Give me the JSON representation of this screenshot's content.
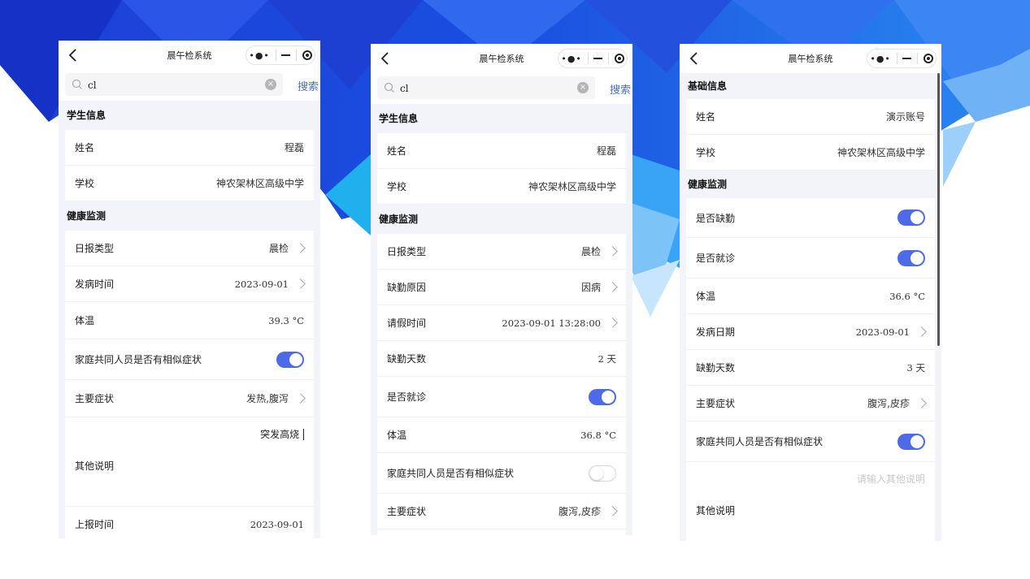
{
  "colors": {
    "accent": "#4d6be8",
    "page_bg": "#f3f4f9",
    "banner_blue": "#1a4fe0"
  },
  "icons": [
    "back-arrow-icon",
    "search-icon",
    "clear-icon",
    "more-dots-icon",
    "minimize-icon",
    "close-target-icon",
    "chevron-right-icon"
  ],
  "phone1": {
    "title": "晨午检系统",
    "search": {
      "value": "cl",
      "button": "搜索"
    },
    "student_section": "学生信息",
    "name_label": "姓名",
    "name_value": "程磊",
    "school_label": "学校",
    "school_value": "神农架林区高级中学",
    "health_section": "健康监测",
    "report_type_label": "日报类型",
    "report_type_value": "晨检",
    "onset_label": "发病时间",
    "onset_value": "2023-09-01",
    "temp_label": "体温",
    "temp_value": "39.3 °C",
    "family_label": "家庭共同人员是否有相似症状",
    "family_on": true,
    "symptoms_label": "主要症状",
    "symptoms_value": "发热,腹泻",
    "other_value": "突发高烧",
    "other_label": "其他说明",
    "report_time_label": "上报时间",
    "report_time_value": "2023-09-01"
  },
  "phone2": {
    "title": "晨午检系统",
    "search": {
      "value": "cl",
      "button": "搜索"
    },
    "student_section": "学生信息",
    "name_label": "姓名",
    "name_value": "程磊",
    "school_label": "学校",
    "school_value": "神农架林区高级中学",
    "health_section": "健康监测",
    "report_type_label": "日报类型",
    "report_type_value": "晨检",
    "absence_reason_label": "缺勤原因",
    "absence_reason_value": "因病",
    "leave_time_label": "请假时间",
    "leave_time_value": "2023-09-01 13:28:00",
    "absence_days_label": "缺勤天数",
    "absence_days_value": "2 天",
    "visited_label": "是否就诊",
    "visited_on": true,
    "temp_label": "体温",
    "temp_value": "36.8 °C",
    "family_label": "家庭共同人员是否有相似症状",
    "family_on": false,
    "symptoms_label": "主要症状",
    "symptoms_value": "腹泻,皮疹"
  },
  "phone3": {
    "title": "晨午检系统",
    "basic_section": "基础信息",
    "name_label": "姓名",
    "name_value": "演示账号",
    "school_label": "学校",
    "school_value": "神农架林区高级中学",
    "health_section": "健康监测",
    "absent_label": "是否缺勤",
    "absent_on": true,
    "visited_label": "是否就诊",
    "visited_on": true,
    "temp_label": "体温",
    "temp_value": "36.6 °C",
    "onset_label": "发病日期",
    "onset_value": "2023-09-01",
    "absence_days_label": "缺勤天数",
    "absence_days_value": "3 天",
    "symptoms_label": "主要症状",
    "symptoms_value": "腹泻,皮疹",
    "family_label": "家庭共同人员是否有相似症状",
    "family_on": true,
    "other_placeholder": "请输入其他说明",
    "other_label": "其他说明"
  }
}
